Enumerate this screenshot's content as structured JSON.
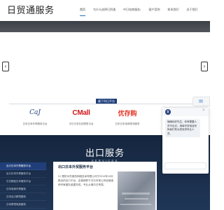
{
  "header": {
    "logo": "日贸通服务",
    "nav": [
      {
        "label": "首页",
        "active": true,
        "caret": false
      },
      {
        "label": "为什么选择日贸通",
        "active": false,
        "caret": false
      },
      {
        "label": "中日电商服务",
        "active": false,
        "caret": true
      },
      {
        "label": "客户案例",
        "active": false,
        "caret": false
      },
      {
        "label": "联系我们",
        "active": false,
        "caret": false
      },
      {
        "label": "关于我们",
        "active": false,
        "caret": false
      }
    ],
    "caret_glyph": "▾"
  },
  "banner": {
    "arrow_left": "‹",
    "arrow_right": "›"
  },
  "partners": {
    "tab_label": "最下列日平台",
    "items": [
      {
        "logo_text": "CaJ",
        "caption": "日本日本外贸服务平台"
      },
      {
        "logo_text": "CMall",
        "caption": "中日日本在线零售平台"
      },
      {
        "logo_text": "优存购",
        "caption": "日本日本电商物流服务"
      }
    ]
  },
  "services": {
    "title": "出口服务",
    "subtitle": "SERVICES",
    "menu": [
      {
        "label": "出口日本外贸服务平台",
        "active": true
      },
      {
        "label": "出口日本外贸服务平台",
        "active": false
      },
      {
        "label": "日日精品日本服务平台",
        "active": false
      },
      {
        "label": "日本电商外贸服务",
        "active": false
      },
      {
        "label": "日本出口跨境服务",
        "active": false
      },
      {
        "label": "日本跨境电商服务",
        "active": false
      }
    ],
    "card_title": "出口日本外贸服务平台",
    "card_text": "CJ 是杭州杰美西网络技术有限公司于2013年10月推出的出口平台，由曾就职于日日本某公司经营者和专家团队组建完成，专业从事中日贸易。"
  },
  "chat": {
    "avatar": "客",
    "close": "×",
    "tab_icon": "✉",
    "message": "嗨嗨你好先生，你有需要人员不出去。请填写您电话号码我们有为您安排专业人员。"
  }
}
